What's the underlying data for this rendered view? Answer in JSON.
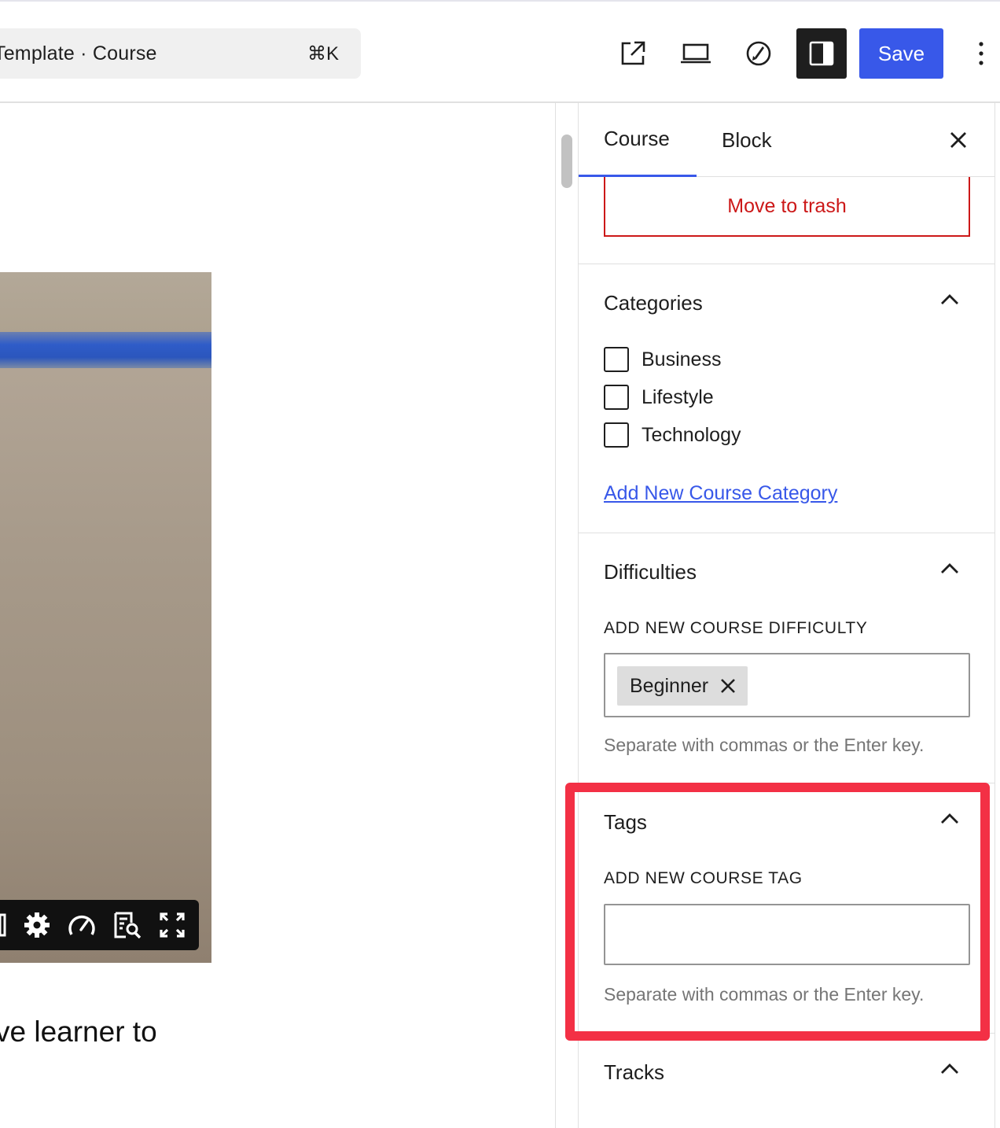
{
  "header": {
    "command_label": "Template · Course",
    "command_shortcut": "⌘K",
    "save_label": "Save",
    "icons": [
      "external-link-icon",
      "laptop-preview-icon",
      "rocket-icon",
      "sidebar-toggle-icon",
      "more-vertical-icon"
    ]
  },
  "canvas": {
    "body_text": "ve learner to"
  },
  "sidebar": {
    "tabs": [
      {
        "label": "Course",
        "active": true
      },
      {
        "label": "Block",
        "active": false
      }
    ],
    "trash_label": "Move to trash",
    "categories": {
      "title": "Categories",
      "items": [
        {
          "label": "Business",
          "checked": false
        },
        {
          "label": "Lifestyle",
          "checked": false
        },
        {
          "label": "Technology",
          "checked": false
        }
      ],
      "add_link": "Add New Course Category"
    },
    "difficulties": {
      "title": "Difficulties",
      "field_label": "ADD NEW COURSE DIFFICULTY",
      "tokens": [
        "Beginner"
      ],
      "help": "Separate with commas or the Enter key."
    },
    "tags": {
      "title": "Tags",
      "field_label": "ADD NEW COURSE TAG",
      "value": "",
      "help": "Separate with commas or the Enter key."
    },
    "tracks": {
      "title": "Tracks"
    }
  },
  "colors": {
    "accent": "#3858e9",
    "danger": "#cc1818",
    "highlight": "#f33045"
  }
}
